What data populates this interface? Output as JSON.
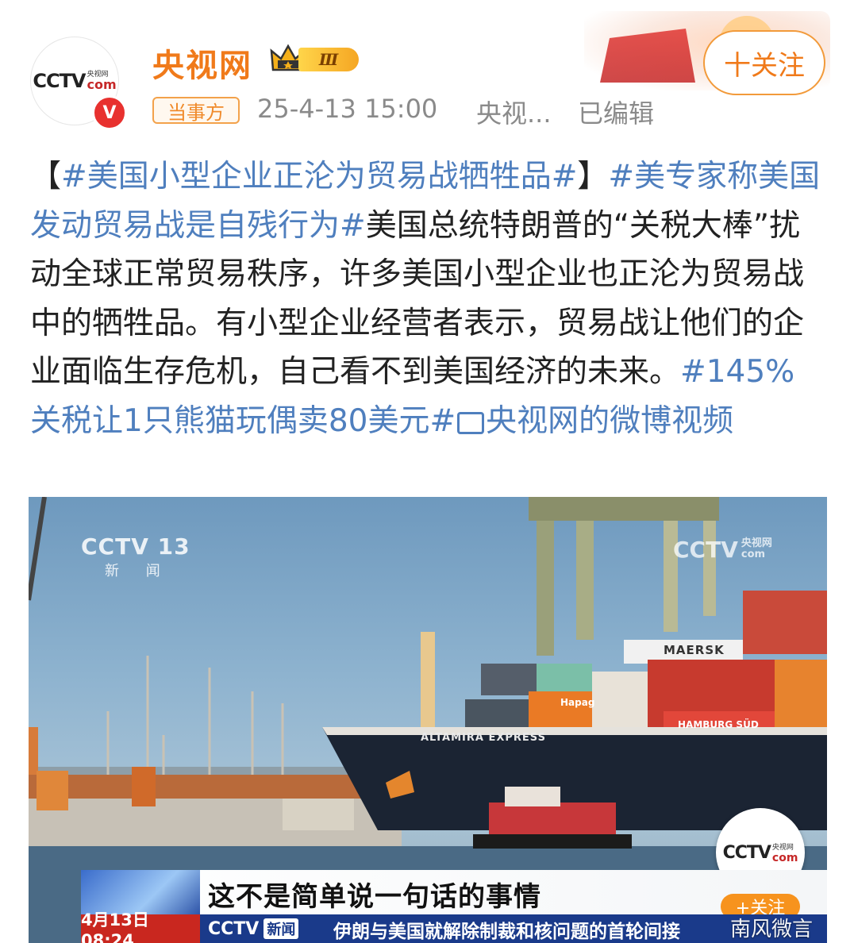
{
  "account": {
    "name": "央视网",
    "avatar_logo": "CCTV",
    "avatar_logo_cn_small": "央视网",
    "avatar_logo_com": "com",
    "verified_mark": "V",
    "level_badge": "Ⅲ",
    "follow_label": "十关注"
  },
  "meta": {
    "tag": "当事方",
    "time": "25-4-13 15:00",
    "source": "央视...",
    "edited": "已编辑"
  },
  "post": {
    "open_bracket": "【",
    "hashtag1": "#美国小型企业正沦为贸易战牺牲品#",
    "close_bracket": "】",
    "hashtag2": "#美专家称美国发动贸易战是自残行为#",
    "body": "美国总统特朗普的“关税大棒”扰动全球正常贸易秩序，许多美国小型企业也正沦为贸易战中的牺牲品。有小型企业经营者表示，贸易战让他们的企业面临生存危机，自己看不到美国经济的未来。",
    "hashtag3": "#145%关税让1只熊猫玩偶卖80美元#",
    "video_link": "央视网的微博视频"
  },
  "video": {
    "channel_logo": "CCTV 13",
    "channel_sub": "新 闻",
    "watermark": "CCTV",
    "watermark_cn": "央视网",
    "watermark_com": "com",
    "ship_name": "ALTAMIRA EXPRESS",
    "container_brand1": "MAERSK",
    "container_brand2": "HAMBURG SÜD",
    "container_brand3": "Hapag",
    "caption": "这不是简单说一句话的事情",
    "ticker_date": "4月13日 08:24",
    "ticker_brand": "CCTV",
    "ticker_news": "新闻",
    "ticker_text": "伊朗与美国就解除制裁和核问题的首轮间接",
    "corner_logo": "CCTV",
    "corner_logo_cn": "央视网",
    "corner_logo_com": "com",
    "corner_follow": "+关注",
    "source_watermark": "南风微言"
  },
  "colors": {
    "name": "#f07a1a",
    "hashtag": "#4f7fbe",
    "verified": "#e8312f",
    "ticker": "#1a3a8a",
    "ticker_date": "#c9271f"
  }
}
